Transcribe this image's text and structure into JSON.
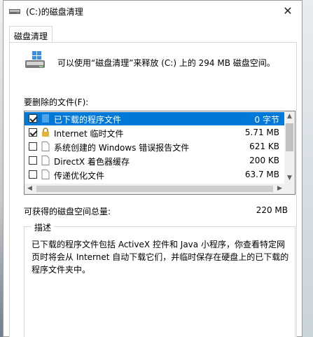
{
  "window": {
    "title": "(C:)的磁盘清理",
    "close_glyph": "✕"
  },
  "tabs": [
    {
      "label": "磁盘清理"
    }
  ],
  "intro_text": "可以使用“磁盘清理”来释放 (C:) 上的 294 MB 磁盘空间。",
  "files_label": "要删除的文件(F):",
  "files": [
    {
      "name": "已下载的程序文件",
      "size": "0 字节",
      "checked": true,
      "selected": true,
      "icon": "folder-icon"
    },
    {
      "name": "Internet 临时文件",
      "size": "5.71 MB",
      "checked": true,
      "selected": false,
      "icon": "lock-icon"
    },
    {
      "name": "系统创建的 Windows 错误报告文件",
      "size": "621 KB",
      "checked": false,
      "selected": false,
      "icon": "file-icon"
    },
    {
      "name": "DirectX 着色器缓存",
      "size": "200 KB",
      "checked": false,
      "selected": false,
      "icon": "file-icon"
    },
    {
      "name": "传递优化文件",
      "size": "63.7 MB",
      "checked": false,
      "selected": false,
      "icon": "file-icon"
    }
  ],
  "gain_label": "可获得的磁盘空间总量:",
  "gain_value": "220 MB",
  "description": {
    "title": "描述",
    "text": "已下载的程序文件包括 ActiveX 控件和 Java 小程序，你查看特定网页时将会从 Internet 自动下载它们，并临时保存在硬盘上的已下载的程序文件夹中。"
  },
  "colors": {
    "selection": "#0078d7",
    "border": "#d9d9d9"
  }
}
